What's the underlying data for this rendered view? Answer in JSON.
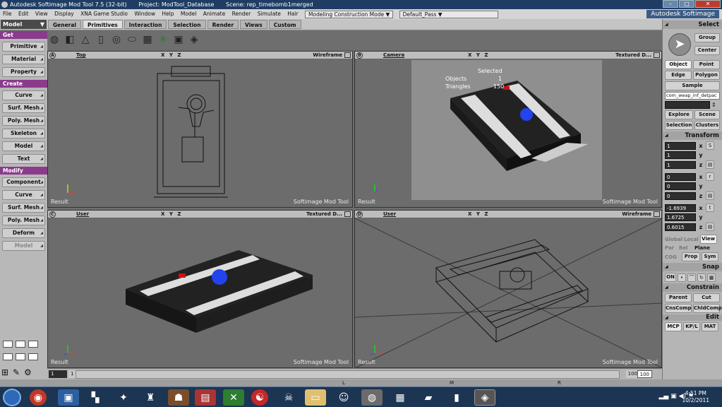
{
  "window": {
    "title": "Autodesk Softimage Mod Tool 7.5 (32-bit)",
    "project": "Project: ModTool_Database",
    "scene": "Scene: rep_timebomb1merged"
  },
  "menus": [
    "File",
    "Edit",
    "View",
    "Display",
    "XNA Game Studio",
    "Window",
    "Help",
    "Model",
    "Animate",
    "Render",
    "Simulate",
    "Hair"
  ],
  "construction_mode": "Modeling Construction Mode",
  "pass": "Default_Pass",
  "brand": "Autodesk Softimage",
  "mode_select": "Model",
  "tabs": [
    "General",
    "Primitives",
    "Interaction",
    "Selection",
    "Render",
    "Views",
    "Custom"
  ],
  "active_tab": "Primitives",
  "left_panel": {
    "get_header": "Get",
    "get_items": [
      "Primitive",
      "Material",
      "Property"
    ],
    "create_header": "Create",
    "create_items": [
      "Curve",
      "Surf. Mesh",
      "Poly. Mesh",
      "Skeleton",
      "Model",
      "Text"
    ],
    "modify_header": "Modify",
    "modify_items": [
      "Component",
      "Curve",
      "Surf. Mesh",
      "Poly. Mesh",
      "Deform",
      "Model"
    ]
  },
  "viewports": {
    "a": {
      "letter": "A",
      "camera": "Top",
      "mode": "Wireframe",
      "xyz": "X Y Z",
      "result": "Result",
      "watermark": "Softimage Mod Tool"
    },
    "b": {
      "letter": "B",
      "camera": "Camera",
      "mode": "Textured D...",
      "xyz": "X Y Z",
      "result": "Result",
      "watermark": "Softimage Mod Tool",
      "stats": {
        "selected": "Selected",
        "objects_label": "Objects",
        "objects_val": "1",
        "triangles_label": "Triangles",
        "triangles_val": "150"
      }
    },
    "c": {
      "letter": "C",
      "camera": "User",
      "mode": "Textured D...",
      "xyz": "X Y Z",
      "result": "Result",
      "watermark": "Softimage Mod Tool"
    },
    "d": {
      "letter": "D",
      "camera": "User",
      "mode": "Wireframe",
      "xyz": "X Y Z",
      "result": "Result",
      "watermark": "Softimage Mod Tool"
    }
  },
  "right_panel": {
    "select_header": "Select",
    "group": "Group",
    "center": "Center",
    "object": "Object",
    "point": "Point",
    "edge": "Edge",
    "polygon": "Polygon",
    "sample": "Sample",
    "selection_name": "com_weap_inf_detpac",
    "explore": "Explore",
    "scene": "Scene",
    "selection": "Selection",
    "clusters": "Clusters",
    "transform_header": "Transform",
    "scale": [
      "1",
      "1",
      "1"
    ],
    "rotation": [
      "0",
      "0",
      "0"
    ],
    "translation": [
      "-1.6939",
      "1.6725",
      "0.6015"
    ],
    "axes": [
      "x",
      "y",
      "z"
    ],
    "global": "Global",
    "local": "Local",
    "view": "View",
    "par": "Par",
    "rel": "Rel",
    "plane": "Plane",
    "cog": "COG",
    "prop": "Prop",
    "sym": "Sym",
    "snap_header": "Snap",
    "on": "ON",
    "constrain_header": "Constrain",
    "parent": "Parent",
    "cut": "Cut",
    "cnscomp": "CnsComp",
    "chldcomp": "ChldComp",
    "edit_header": "Edit",
    "mcp": "MCP",
    "kpl": "KP/L",
    "mat": "MAT"
  },
  "timeline": {
    "start": "1",
    "current": "1",
    "end": "100",
    "end2": "100"
  },
  "status_letters": [
    "L",
    "M",
    "R"
  ],
  "clock": {
    "time": "4:51 PM",
    "date": "10/2/2011"
  }
}
